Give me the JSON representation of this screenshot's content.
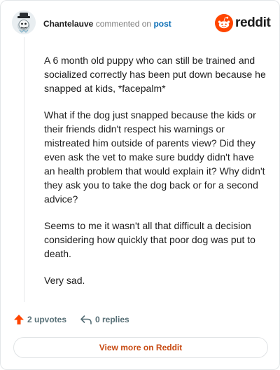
{
  "comment": {
    "username": "Chantelauve",
    "action": "commented on",
    "post_link": "post",
    "paragraphs": [
      "A 6 month old puppy who can still be trained and socialized correctly has been put down because he snapped at kids, *facepalm*",
      "What if the dog just snapped because the kids or their friends didn't respect his warnings or mistreated him outside of parents view? Did they even ask the vet to make sure buddy didn't have an health problem that would explain it? Why didn't they ask you to take the dog back or for a second advice?",
      "Seems to me it wasn't all that difficult a decision considering how quickly that poor dog was put to death.",
      "Very sad."
    ]
  },
  "brand": {
    "wordmark": "reddit",
    "color": "#ff4500"
  },
  "icons": {
    "avatar": "avatar-icon",
    "upvote": "upvote-arrow-icon",
    "reply": "reply-arrow-icon"
  },
  "stats": {
    "upvotes": "2 upvotes",
    "replies": "0 replies"
  },
  "cta": {
    "label": "View more on Reddit"
  }
}
